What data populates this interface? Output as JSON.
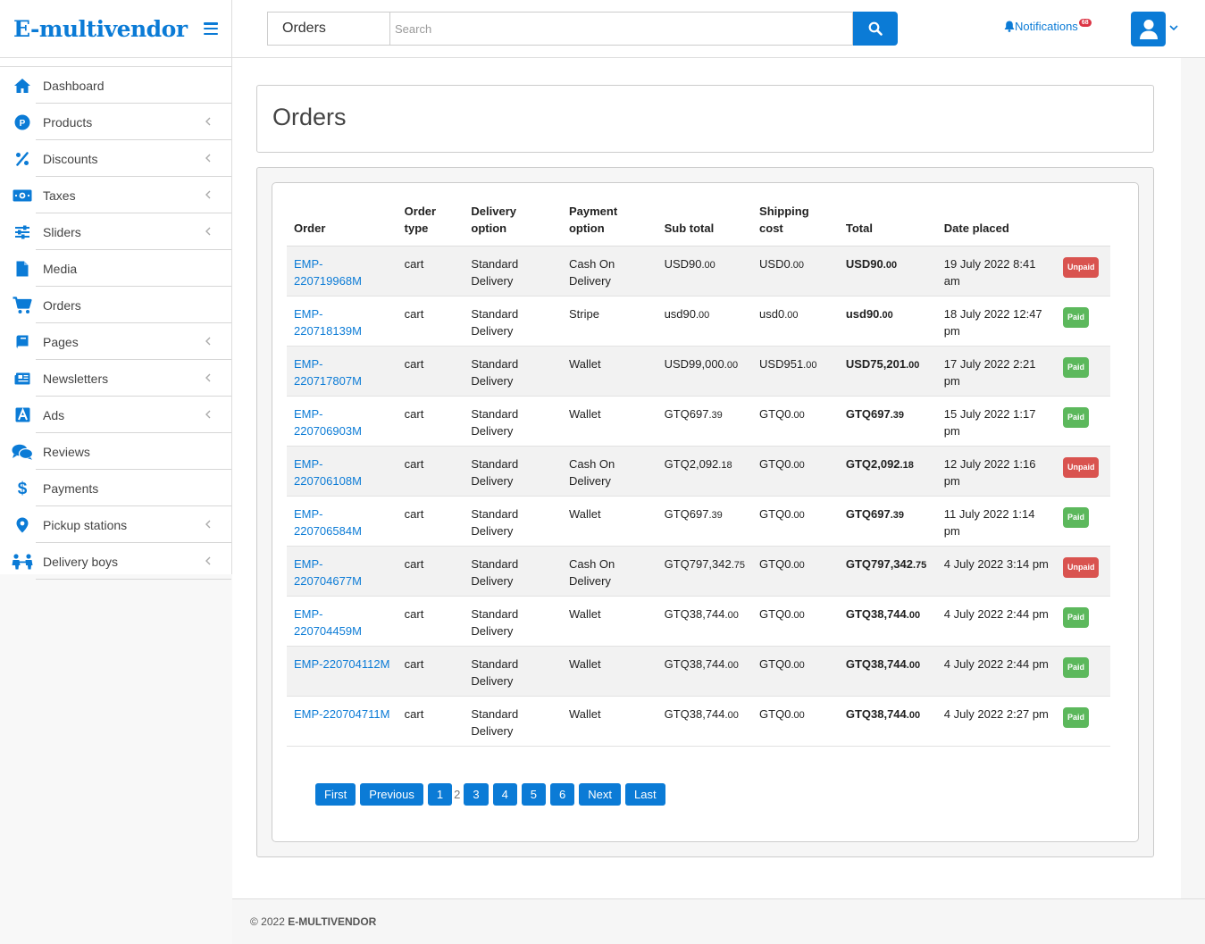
{
  "brand": {
    "name": "E-multivendor"
  },
  "sidebar": {
    "items": [
      {
        "label": "Dashboard",
        "icon": "home-icon",
        "chevron": false
      },
      {
        "label": "Products",
        "icon": "product-icon",
        "chevron": true
      },
      {
        "label": "Discounts",
        "icon": "percent-icon",
        "chevron": true
      },
      {
        "label": "Taxes",
        "icon": "money-icon",
        "chevron": true
      },
      {
        "label": "Sliders",
        "icon": "sliders-icon",
        "chevron": true
      },
      {
        "label": "Media",
        "icon": "file-icon",
        "chevron": false
      },
      {
        "label": "Orders",
        "icon": "cart-icon",
        "chevron": false
      },
      {
        "label": "Pages",
        "icon": "book-icon",
        "chevron": true
      },
      {
        "label": "Newsletters",
        "icon": "newspaper-icon",
        "chevron": true
      },
      {
        "label": "Ads",
        "icon": "ad-icon",
        "chevron": true
      },
      {
        "label": "Reviews",
        "icon": "comments-icon",
        "chevron": false
      },
      {
        "label": "Payments",
        "icon": "dollar-icon",
        "chevron": false
      },
      {
        "label": "Pickup stations",
        "icon": "map-marker-icon",
        "chevron": true
      },
      {
        "label": "Delivery boys",
        "icon": "people-icon",
        "chevron": true
      }
    ]
  },
  "topbar": {
    "search_category": "Orders",
    "search_placeholder": "Search",
    "notifications_label": "Notifications",
    "notifications_count": "68"
  },
  "page": {
    "title": "Orders"
  },
  "table": {
    "headers": [
      "Order",
      "Order type",
      "Delivery option",
      "Payment option",
      "Sub total",
      "Shipping cost",
      "Total",
      "Date placed",
      ""
    ],
    "rows": [
      {
        "order": "EMP-220719968M",
        "type": "cart",
        "delivery": "Standard Delivery",
        "payment": "Cash On Delivery",
        "sub_main": "USD90",
        "sub_cents": ".00",
        "ship_main": "USD0",
        "ship_cents": ".00",
        "total_main": "USD90",
        "total_cents": ".00",
        "date": "19 July 2022 8:41 am",
        "status": "Unpaid"
      },
      {
        "order": "EMP-220718139M",
        "type": "cart",
        "delivery": "Standard Delivery",
        "payment": "Stripe",
        "sub_main": "usd90",
        "sub_cents": ".00",
        "ship_main": "usd0",
        "ship_cents": ".00",
        "total_main": "usd90",
        "total_cents": ".00",
        "date": "18 July 2022 12:47 pm",
        "status": "Paid"
      },
      {
        "order": "EMP-220717807M",
        "type": "cart",
        "delivery": "Standard Delivery",
        "payment": "Wallet",
        "sub_main": "USD99,000",
        "sub_cents": ".00",
        "ship_main": "USD951",
        "ship_cents": ".00",
        "total_main": "USD75,201",
        "total_cents": ".00",
        "date": "17 July 2022 2:21 pm",
        "status": "Paid"
      },
      {
        "order": "EMP-220706903M",
        "type": "cart",
        "delivery": "Standard Delivery",
        "payment": "Wallet",
        "sub_main": "GTQ697",
        "sub_cents": ".39",
        "ship_main": "GTQ0",
        "ship_cents": ".00",
        "total_main": "GTQ697",
        "total_cents": ".39",
        "date": "15 July 2022 1:17 pm",
        "status": "Paid"
      },
      {
        "order": "EMP-220706108M",
        "type": "cart",
        "delivery": "Standard Delivery",
        "payment": "Cash On Delivery",
        "sub_main": "GTQ2,092",
        "sub_cents": ".18",
        "ship_main": "GTQ0",
        "ship_cents": ".00",
        "total_main": "GTQ2,092",
        "total_cents": ".18",
        "date": "12 July 2022 1:16 pm",
        "status": "Unpaid"
      },
      {
        "order": "EMP-220706584M",
        "type": "cart",
        "delivery": "Standard Delivery",
        "payment": "Wallet",
        "sub_main": "GTQ697",
        "sub_cents": ".39",
        "ship_main": "GTQ0",
        "ship_cents": ".00",
        "total_main": "GTQ697",
        "total_cents": ".39",
        "date": "11 July 2022 1:14 pm",
        "status": "Paid"
      },
      {
        "order": "EMP-220704677M",
        "type": "cart",
        "delivery": "Standard Delivery",
        "payment": "Cash On Delivery",
        "sub_main": "GTQ797,342",
        "sub_cents": ".75",
        "ship_main": "GTQ0",
        "ship_cents": ".00",
        "total_main": "GTQ797,342",
        "total_cents": ".75",
        "date": "4 July 2022 3:14 pm",
        "status": "Unpaid"
      },
      {
        "order": "EMP-220704459M",
        "type": "cart",
        "delivery": "Standard Delivery",
        "payment": "Wallet",
        "sub_main": "GTQ38,744",
        "sub_cents": ".00",
        "ship_main": "GTQ0",
        "ship_cents": ".00",
        "total_main": "GTQ38,744",
        "total_cents": ".00",
        "date": "4 July 2022 2:44 pm",
        "status": "Paid"
      },
      {
        "order": "EMP-220704112M",
        "type": "cart",
        "delivery": "Standard Delivery",
        "payment": "Wallet",
        "sub_main": "GTQ38,744",
        "sub_cents": ".00",
        "ship_main": "GTQ0",
        "ship_cents": ".00",
        "total_main": "GTQ38,744",
        "total_cents": ".00",
        "date": "4 July 2022 2:44 pm",
        "status": "Paid"
      },
      {
        "order": "EMP-220704711M",
        "type": "cart",
        "delivery": "Standard Delivery",
        "payment": "Wallet",
        "sub_main": "GTQ38,744",
        "sub_cents": ".00",
        "ship_main": "GTQ0",
        "ship_cents": ".00",
        "total_main": "GTQ38,744",
        "total_cents": ".00",
        "date": "4 July 2022 2:27 pm",
        "status": "Paid"
      }
    ]
  },
  "pagination": {
    "first": "First",
    "previous": "Previous",
    "pages_before": [
      "1"
    ],
    "current": "2",
    "pages_after": [
      "3",
      "4",
      "5",
      "6"
    ],
    "next": "Next",
    "last": "Last"
  },
  "footer": {
    "prefix": "© 2022",
    "brand": "E-MULTIVENDOR"
  },
  "colors": {
    "accent": "#0b7bd6",
    "paid": "#5cb85c",
    "unpaid": "#d9534f"
  }
}
